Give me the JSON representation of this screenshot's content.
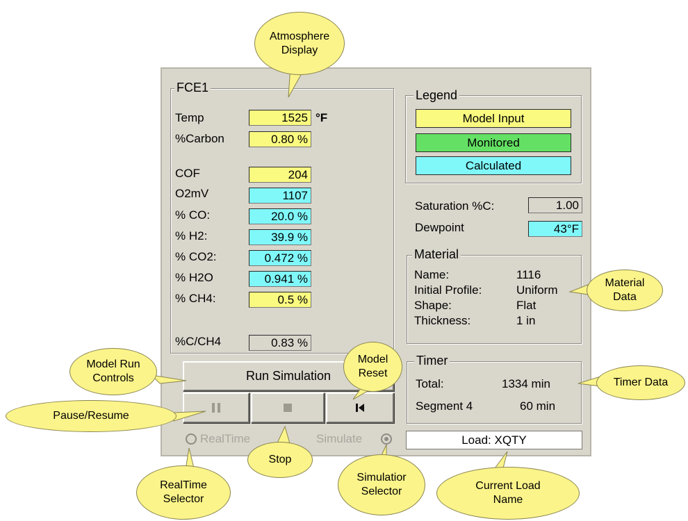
{
  "group_title": "FCE1",
  "atmosphere": {
    "temp": {
      "label": "Temp",
      "value": "1525",
      "unit": "°F"
    },
    "carbon": {
      "label": "%Carbon",
      "value": "0.80 %"
    },
    "cof": {
      "label": "COF",
      "value": "204"
    },
    "o2mv": {
      "label": "O2mV",
      "value": "1107"
    },
    "co": {
      "label": "% CO:",
      "value": "20.0 %"
    },
    "h2": {
      "label": "% H2:",
      "value": "39.9 %"
    },
    "co2": {
      "label": "% CO2:",
      "value": "0.472 %"
    },
    "h2o": {
      "label": "% H2O",
      "value": "0.941 %"
    },
    "ch4": {
      "label": "% CH4:",
      "value": "0.5 %"
    },
    "c_ch4": {
      "label": "%C/CH4",
      "value": "0.83 %"
    }
  },
  "legend": {
    "title": "Legend",
    "model_input": "Model Input",
    "monitored": "Monitored",
    "calculated": "Calculated"
  },
  "saturation": {
    "label": "Saturation %C:",
    "value": "1.00"
  },
  "dewpoint": {
    "label": "Dewpoint",
    "value": "43°F"
  },
  "material": {
    "title": "Material",
    "name_label": "Name:",
    "name_value": "1116",
    "profile_label": "Initial Profile:",
    "profile_value": "Uniform",
    "shape_label": "Shape:",
    "shape_value": "Flat",
    "thickness_label": "Thickness:",
    "thickness_value": "1 in"
  },
  "timer": {
    "title": "Timer",
    "total_label": "Total:",
    "total_value": "1334 min",
    "segment_label": "Segment 4",
    "segment_value": "60 min"
  },
  "controls": {
    "run_label": "Run Simulation",
    "pause_icon": "pause-icon",
    "stop_icon": "stop-icon",
    "reset_icon": "skip-to-start-icon",
    "realtime_label": "RealTime",
    "simulate_label": "Simulate",
    "selected_mode": "Simulate"
  },
  "load": {
    "text": "Load: XQTY"
  },
  "callouts": {
    "atmosphere": "Atmosphere\nDisplay",
    "model_run": "Model Run\nControls",
    "model_reset": "Model\nReset",
    "pause": "Pause/Resume",
    "stop": "Stop",
    "realtime": "RealTime\nSelector",
    "simulation": "Simulatior\nSelector",
    "current_load": "Current Load\nName",
    "material": "Material\nData",
    "timer": "Timer Data"
  },
  "colors": {
    "model_input": "#fafa80",
    "monitored": "#64e164",
    "calculated": "#80f8fa",
    "panel": "#d9d6cc",
    "callout": "#fbf48a"
  }
}
